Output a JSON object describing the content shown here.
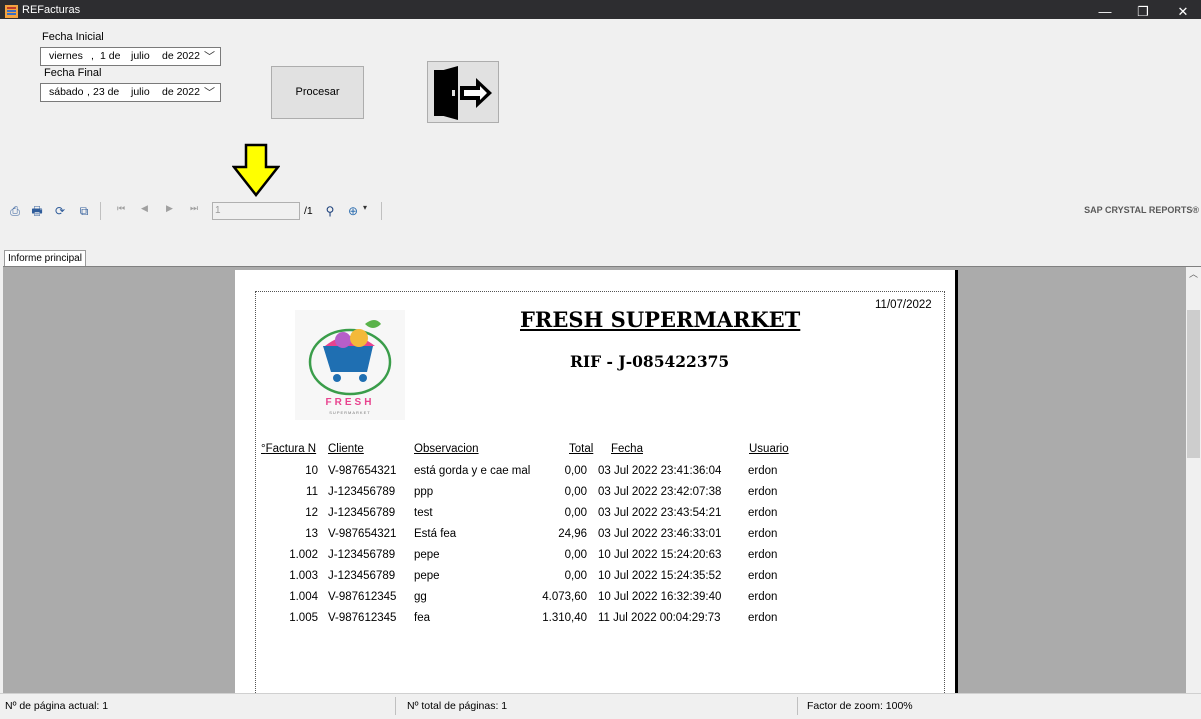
{
  "window": {
    "title": "REFacturas",
    "controls": {
      "minimize": "—",
      "maximize": "❐",
      "close": "✕"
    }
  },
  "form": {
    "fecha_inicial_label": "Fecha Inicial",
    "fecha_inicial": {
      "weekday": "viernes",
      "day": "1 de",
      "month": "julio",
      "year": "de 2022"
    },
    "fecha_final_label": "Fecha Final",
    "fecha_final": {
      "weekday": "sábado",
      "day": "23 de",
      "month": "julio",
      "year": "de 2022"
    },
    "procesar_label": "Procesar"
  },
  "toolbar": {
    "page_input": "1",
    "page_total": "/1",
    "brand": "SAP CRYSTAL REPORTS®"
  },
  "tab": {
    "label": "Informe principal"
  },
  "report": {
    "company": "FRESH SUPERMARKET",
    "rif": "RIF - J-085422375",
    "printed_date": "11/07/2022",
    "logo_text": "FRESH",
    "logo_subtext": "SUPERMARKET",
    "columns": [
      "Factura N°",
      "Cliente",
      "Observacion",
      "Total",
      "Fecha",
      "Usuario"
    ],
    "rows": [
      {
        "num": "10",
        "cliente": "V-987654321",
        "obs": "está gorda y e cae mal",
        "total": "0,00",
        "fecha": "03 Jul 2022 23:41:36:04",
        "usuario": "erdon"
      },
      {
        "num": "11",
        "cliente": "J-123456789",
        "obs": "ppp",
        "total": "0,00",
        "fecha": "03 Jul 2022 23:42:07:38",
        "usuario": "erdon"
      },
      {
        "num": "12",
        "cliente": "J-123456789",
        "obs": "test",
        "total": "0,00",
        "fecha": "03 Jul 2022 23:43:54:21",
        "usuario": "erdon"
      },
      {
        "num": "13",
        "cliente": "V-987654321",
        "obs": "Está fea",
        "total": "24,96",
        "fecha": "03 Jul 2022 23:46:33:01",
        "usuario": "erdon"
      },
      {
        "num": "1.002",
        "cliente": "J-123456789",
        "obs": "pepe",
        "total": "0,00",
        "fecha": "10 Jul 2022 15:24:20:63",
        "usuario": "erdon"
      },
      {
        "num": "1.003",
        "cliente": "J-123456789",
        "obs": "pepe",
        "total": "0,00",
        "fecha": "10 Jul 2022 15:24:35:52",
        "usuario": "erdon"
      },
      {
        "num": "1.004",
        "cliente": "V-987612345",
        "obs": "gg",
        "total": "4.073,60",
        "fecha": "10 Jul 2022 16:32:39:40",
        "usuario": "erdon"
      },
      {
        "num": "1.005",
        "cliente": "V-987612345",
        "obs": "fea",
        "total": "1.310,40",
        "fecha": "11 Jul 2022 00:04:29:73",
        "usuario": "erdon"
      }
    ]
  },
  "status": {
    "current_page": "Nº de página actual: 1",
    "total_pages": "Nº total de páginas: 1",
    "zoom": "Factor de zoom: 100%"
  }
}
